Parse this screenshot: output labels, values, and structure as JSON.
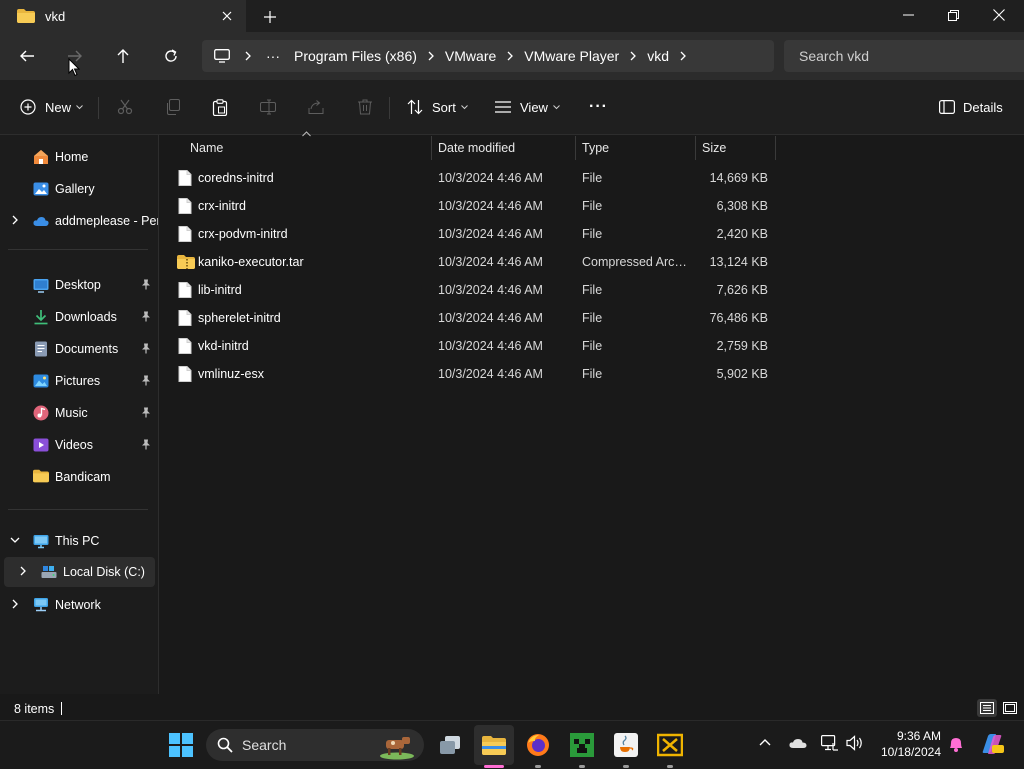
{
  "window": {
    "tab_title": "vkd",
    "new_tab": "+"
  },
  "address": {
    "crumbs": [
      "Program Files (x86)",
      "VMware",
      "VMware Player",
      "vkd"
    ],
    "overflow": "···"
  },
  "search": {
    "placeholder": "Search vkd"
  },
  "toolbar": {
    "new_label": "New",
    "sort_label": "Sort",
    "view_label": "View",
    "more_label": "···",
    "details_label": "Details"
  },
  "sidebar": {
    "items": [
      {
        "label": "Home",
        "icon": "home-icon"
      },
      {
        "label": "Gallery",
        "icon": "gallery-icon"
      },
      {
        "label": "addmeplease - Pers",
        "icon": "onedrive-icon"
      },
      {
        "label": "Desktop",
        "icon": "desktop-icon"
      },
      {
        "label": "Downloads",
        "icon": "download-icon"
      },
      {
        "label": "Documents",
        "icon": "documents-icon"
      },
      {
        "label": "Pictures",
        "icon": "pictures-icon"
      },
      {
        "label": "Music",
        "icon": "music-icon"
      },
      {
        "label": "Videos",
        "icon": "videos-icon"
      },
      {
        "label": "Bandicam",
        "icon": "folder-icon"
      },
      {
        "label": "This PC",
        "icon": "pc-icon"
      },
      {
        "label": "Local Disk (C:)",
        "icon": "disk-icon"
      },
      {
        "label": "Network",
        "icon": "network-icon"
      }
    ]
  },
  "columns": [
    "Name",
    "Date modified",
    "Type",
    "Size"
  ],
  "files": [
    {
      "name": "coredns-initrd",
      "date": "10/3/2024 4:46 AM",
      "type": "File",
      "size": "14,669 KB",
      "icon": "file-icon"
    },
    {
      "name": "crx-initrd",
      "date": "10/3/2024 4:46 AM",
      "type": "File",
      "size": "6,308 KB",
      "icon": "file-icon"
    },
    {
      "name": "crx-podvm-initrd",
      "date": "10/3/2024 4:46 AM",
      "type": "File",
      "size": "2,420 KB",
      "icon": "file-icon"
    },
    {
      "name": "kaniko-executor.tar",
      "date": "10/3/2024 4:46 AM",
      "type": "Compressed Archi...",
      "size": "13,124 KB",
      "icon": "archive-folder-icon"
    },
    {
      "name": "lib-initrd",
      "date": "10/3/2024 4:46 AM",
      "type": "File",
      "size": "7,626 KB",
      "icon": "file-icon"
    },
    {
      "name": "spherelet-initrd",
      "date": "10/3/2024 4:46 AM",
      "type": "File",
      "size": "76,486 KB",
      "icon": "file-icon"
    },
    {
      "name": "vkd-initrd",
      "date": "10/3/2024 4:46 AM",
      "type": "File",
      "size": "2,759 KB",
      "icon": "file-icon"
    },
    {
      "name": "vmlinuz-esx",
      "date": "10/3/2024 4:46 AM",
      "type": "File",
      "size": "5,902 KB",
      "icon": "file-icon"
    }
  ],
  "status": {
    "count": "8 items"
  },
  "taskbar": {
    "search_label": "Search",
    "time": "9:36 AM",
    "date": "10/18/2024"
  }
}
